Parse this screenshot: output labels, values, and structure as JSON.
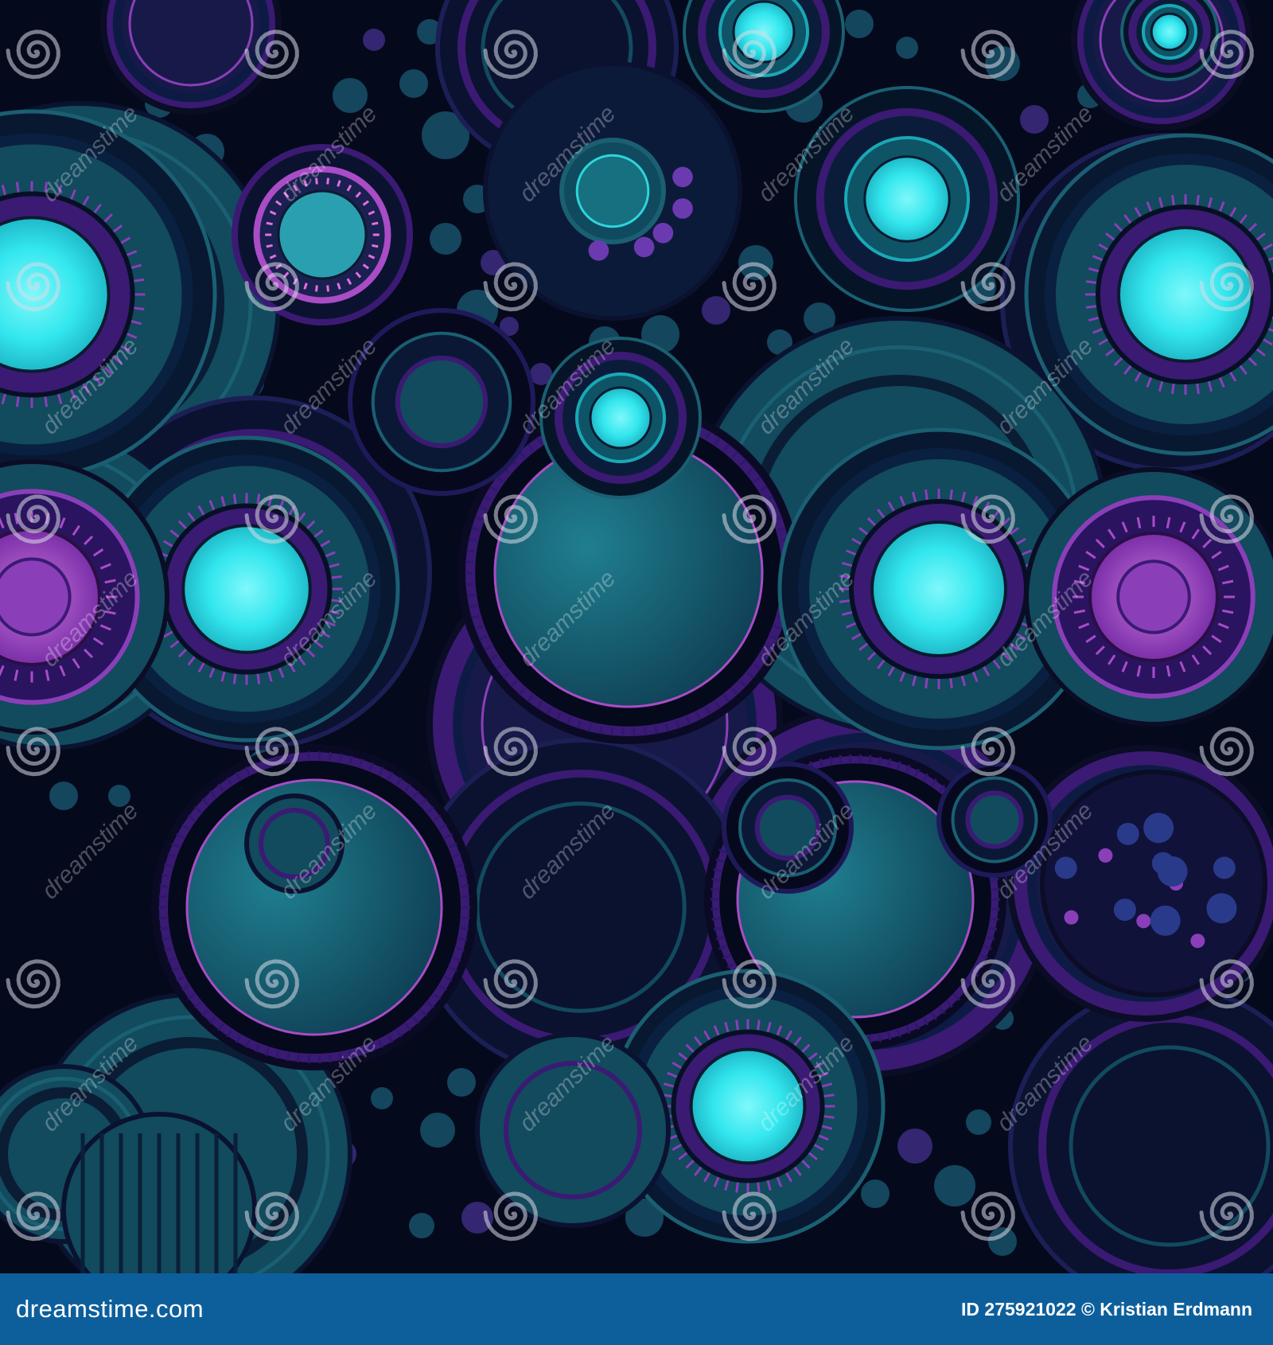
{
  "image": {
    "subject": "seamless pattern of overlapping neon teal and purple circles on dark navy",
    "colors": {
      "background": "#05091c",
      "teal": "#1a5f72",
      "teal_deep": "#124a5e",
      "cyan_glow": "#33e7ee",
      "purple": "#3b1a73",
      "violet": "#8a3fb8",
      "magenta": "#a94cc6",
      "navy": "#0d1b44",
      "dot_teal": "#164e66",
      "dot_purple": "#3a2a7a"
    }
  },
  "watermark": {
    "text": "dreamstime",
    "icon": "spiral-logo-icon"
  },
  "footer": {
    "brand": "dreamstime.com",
    "credit": "ID 275921022 © Kristian Erdmann",
    "background": "#0d5f9c",
    "text_color": "#ffffff"
  }
}
